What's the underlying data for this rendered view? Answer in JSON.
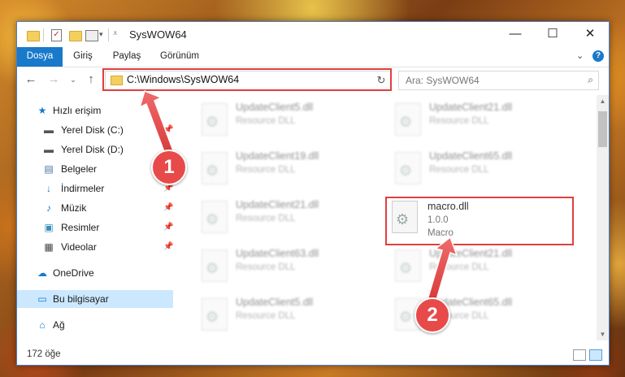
{
  "window": {
    "title": "SysWOW64",
    "controls": {
      "minimize": "—",
      "maximize": "☐",
      "close": "✕"
    }
  },
  "ribbon": {
    "tabs": [
      "Dosya",
      "Giriş",
      "Paylaş",
      "Görünüm"
    ],
    "active_tab": "Dosya",
    "help": "?"
  },
  "address": {
    "path": "C:\\Windows\\SysWOW64",
    "search_placeholder": "Ara: SysWOW64"
  },
  "sidebar": {
    "items": [
      {
        "label": "Hızlı erişim",
        "icon": "star-icon"
      },
      {
        "label": "Yerel Disk (C:)",
        "icon": "drive-icon",
        "pinned": true
      },
      {
        "label": "Yerel Disk (D:)",
        "icon": "drive-icon"
      },
      {
        "label": "Belgeler",
        "icon": "documents-icon"
      },
      {
        "label": "İndirmeler",
        "icon": "download-icon",
        "pinned": true
      },
      {
        "label": "Müzik",
        "icon": "music-icon",
        "pinned": true
      },
      {
        "label": "Resimler",
        "icon": "pictures-icon",
        "pinned": true
      },
      {
        "label": "Videolar",
        "icon": "video-icon",
        "pinned": true
      },
      {
        "label": "OneDrive",
        "icon": "cloud-icon"
      },
      {
        "label": "Bu bilgisayar",
        "icon": "computer-icon",
        "selected": true
      },
      {
        "label": "Ağ",
        "icon": "network-icon"
      }
    ]
  },
  "files": [
    {
      "name": "UpdateClient5.dll",
      "type": "Resource DLL"
    },
    {
      "name": "UpdateClient21.dll",
      "type": "Resource DLL"
    },
    {
      "name": "UpdateClient19.dll",
      "type": "Resource DLL"
    },
    {
      "name": "UpdateClient65.dll",
      "type": "Resource DLL"
    },
    {
      "name": "UpdateClient21.dll",
      "type": "Resource DLL"
    },
    {
      "name": "macro.dll",
      "version": "1.0.0",
      "description": "Macro"
    },
    {
      "name": "UpdateClient63.dll",
      "type": "Resource DLL"
    },
    {
      "name": "UpdateClient21.dll",
      "type": "Resource DLL"
    },
    {
      "name": "UpdateClient5.dll",
      "type": "Resource DLL"
    },
    {
      "name": "UpdateClient65.dll",
      "type": "Resource DLL"
    }
  ],
  "status": {
    "item_count": "172 öğe"
  },
  "annotations": {
    "step1": "1",
    "step2": "2",
    "color": "#e84a4a"
  }
}
